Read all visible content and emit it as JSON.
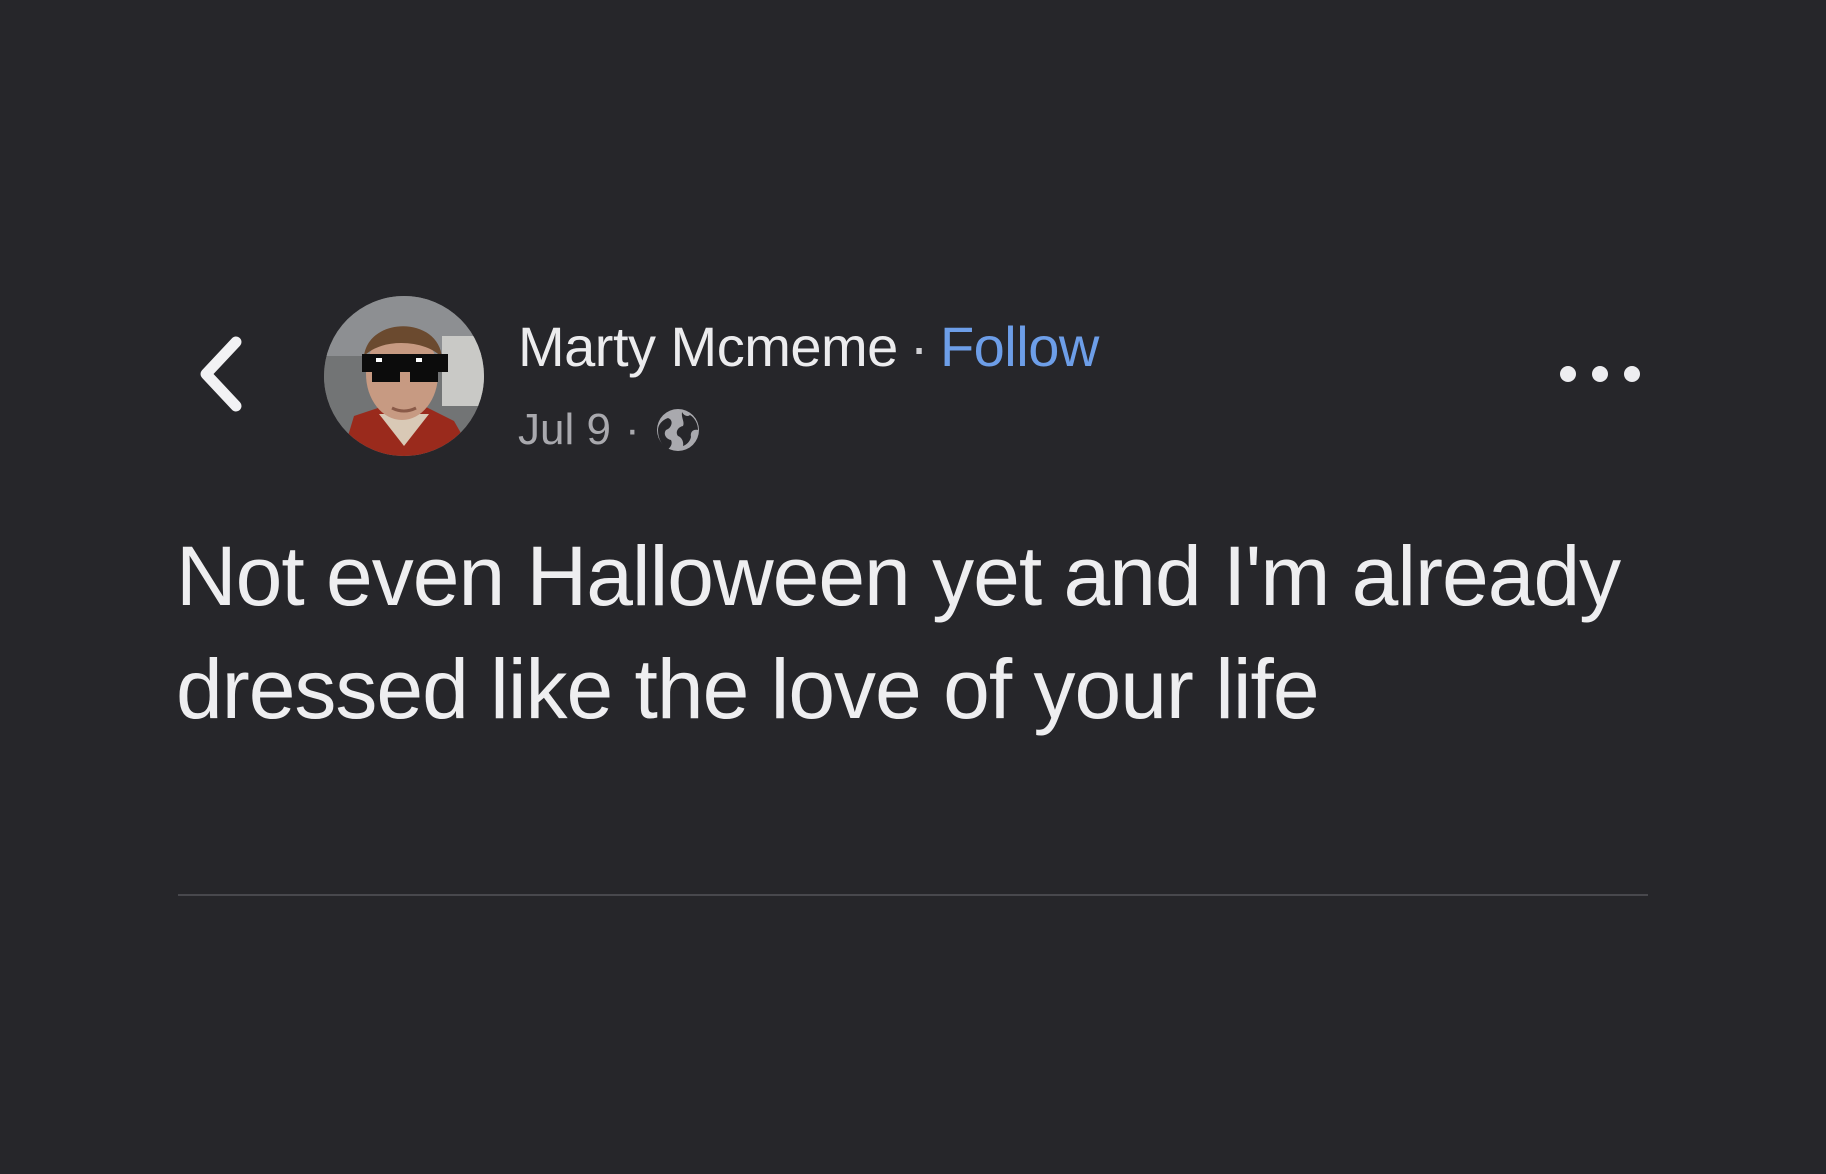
{
  "post": {
    "author_name": "Marty Mcmeme",
    "separator": "·",
    "follow_label": "Follow",
    "date": "Jul 9",
    "meta_separator": "·",
    "privacy_icon": "globe-icon",
    "text": "Not even Halloween yet and I'm already dressed like the love of your life"
  },
  "icons": {
    "back": "chevron-left-icon",
    "more": "more-horizontal-icon"
  },
  "colors": {
    "background": "#26262a",
    "text": "#eeeef0",
    "meta": "#a9a9ae",
    "link": "#6d9ee8"
  }
}
